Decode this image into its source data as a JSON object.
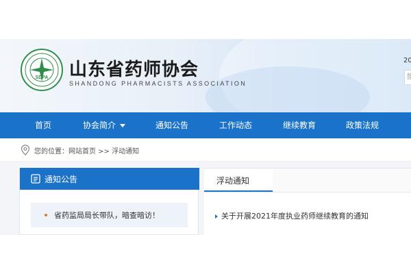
{
  "header": {
    "logo_text": "SDPA",
    "title": "山东省药师协会",
    "subtitle": "SHANDONG PHARMACISTS ASSOCIATION",
    "date_stub": "20",
    "search_stub": "搜"
  },
  "nav": {
    "items": [
      {
        "label": "首页"
      },
      {
        "label": "协会简介"
      },
      {
        "label": "通知公告"
      },
      {
        "label": "工作动态"
      },
      {
        "label": "继续教育"
      },
      {
        "label": "政策法规"
      }
    ]
  },
  "breadcrumb": {
    "prefix": "您的位置：",
    "home": "网站首页",
    "sep": " >> ",
    "current": "浮动通知"
  },
  "left_panel": {
    "title": "通知公告",
    "items": [
      {
        "text": "省药监局局长带队，暗查暗访！"
      }
    ]
  },
  "right_panel": {
    "tab": "浮动通知",
    "items": [
      {
        "text": "关于开展2021年度执业药师继续教育的通知"
      }
    ]
  },
  "colors": {
    "brand_blue": "#1a73c9",
    "logo_green": "#2f8f4a",
    "bullet_orange": "#e07b21"
  }
}
